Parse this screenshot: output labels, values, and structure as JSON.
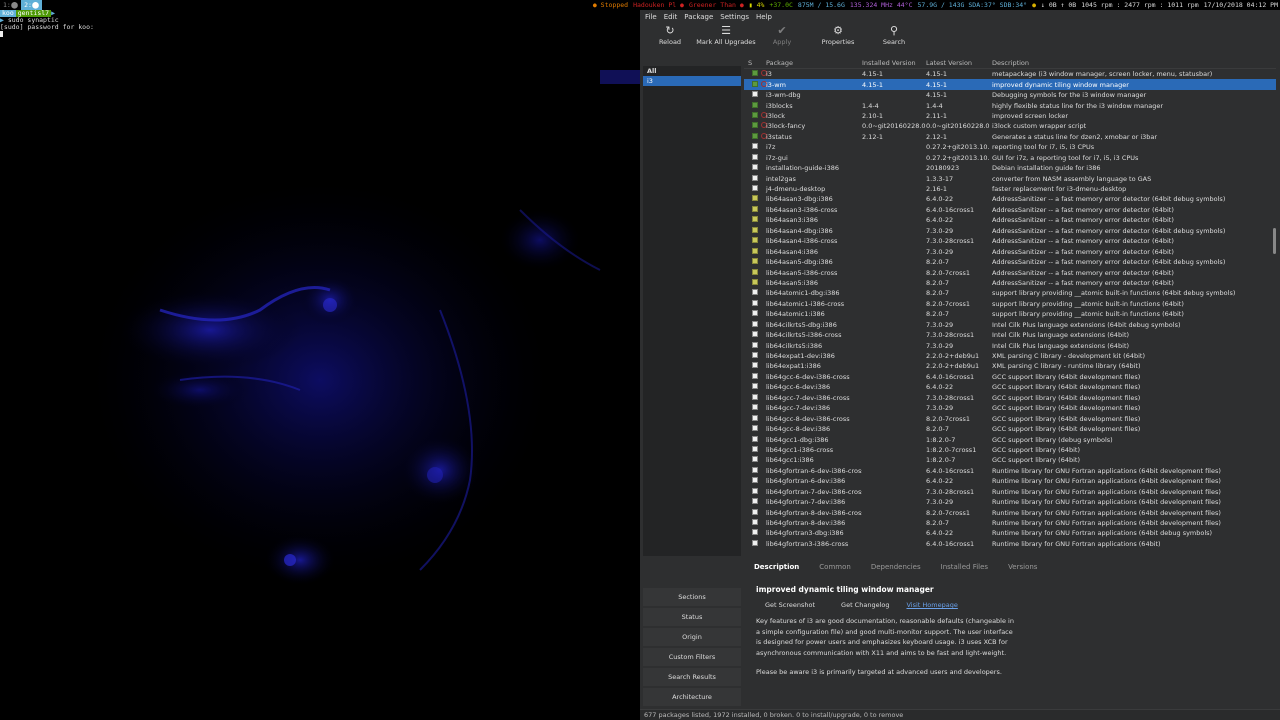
{
  "topbar": {
    "workspaces": [
      {
        "label": "1:⬤",
        "active": false
      },
      {
        "label": "2:⬤",
        "active": true
      }
    ],
    "status": [
      {
        "text": "● Stopped",
        "color": "#e07b00"
      },
      {
        "text": "Hadouken Pl ●",
        "color": "#c22"
      },
      {
        "text": "Greener Than ●",
        "color": "#c22"
      },
      {
        "text": "▮ 4%",
        "color": "#d7d700"
      },
      {
        "text": "+37.0C",
        "color": "#5faf00"
      },
      {
        "text": "875M / 15.6G",
        "color": "#5fafd7"
      },
      {
        "text": "135.324 MHz 44°C",
        "color": "#af5fd7"
      },
      {
        "text": "57.9G / 143G SDA:37° SDB:34°",
        "color": "#5fafd7"
      },
      {
        "text": "●",
        "color": "#d7af00"
      },
      {
        "text": "↓ 0B ↑ 0B",
        "color": "#ddd"
      },
      {
        "text": "1045 rpm : 2477 rpm : 1011 rpm",
        "color": "#ddd"
      },
      {
        "text": "17/10/2018 04:12 PM",
        "color": "#ddd"
      }
    ]
  },
  "terminal": {
    "prompt_user": "koo",
    "prompt_path": "gentisl7",
    "command": " sudo synaptic",
    "password_line": "[sudo] password for koo:"
  },
  "synaptic": {
    "menu": [
      "File",
      "Edit",
      "Package",
      "Settings",
      "Help"
    ],
    "toolbar": [
      {
        "label": "Reload",
        "icon": "reload-icon",
        "glyph": "↻",
        "disabled": false
      },
      {
        "label": "Mark All Upgrades",
        "icon": "mark-upgrades-icon",
        "glyph": "☰",
        "disabled": false
      },
      {
        "label": "Apply",
        "icon": "apply-icon",
        "glyph": "✔",
        "disabled": true
      },
      {
        "label": "Properties",
        "icon": "properties-icon",
        "glyph": "⚙",
        "disabled": false
      },
      {
        "label": "Search",
        "icon": "search-icon",
        "glyph": "⚲",
        "disabled": false
      }
    ],
    "filters": {
      "header": "All",
      "items": [
        "i3"
      ]
    },
    "columns": {
      "s": "S",
      "package": "Package",
      "installed": "Installed Version",
      "latest": "Latest Version",
      "description": "Description"
    },
    "packages": [
      {
        "name": "i3",
        "installed": "4.15-1",
        "latest": "4.15-1",
        "desc": "metapackage (i3 window manager, screen locker, menu, statusbar)",
        "state": "installed",
        "sup": true
      },
      {
        "name": "i3-wm",
        "installed": "4.15-1",
        "latest": "4.15-1",
        "desc": "improved dynamic tiling window manager",
        "state": "installed",
        "sup": true,
        "selected": true
      },
      {
        "name": "i3-wm-dbg",
        "installed": "",
        "latest": "4.15-1",
        "desc": "Debugging symbols for the i3 window manager",
        "state": "none",
        "sup": false
      },
      {
        "name": "i3blocks",
        "installed": "1.4-4",
        "latest": "1.4-4",
        "desc": "highly flexible status line for the i3 window manager",
        "state": "installed",
        "sup": false
      },
      {
        "name": "i3lock",
        "installed": "2.10-1",
        "latest": "2.11-1",
        "desc": "improved screen locker",
        "state": "installed",
        "sup": true
      },
      {
        "name": "i3lock-fancy",
        "installed": "0.0~git20160228.0",
        "latest": "0.0~git20160228.0",
        "desc": "i3lock custom wrapper script",
        "state": "installed",
        "sup": true
      },
      {
        "name": "i3status",
        "installed": "2.12-1",
        "latest": "2.12-1",
        "desc": "Generates a status line for dzen2, xmobar or i3bar",
        "state": "installed",
        "sup": true
      },
      {
        "name": "i7z",
        "installed": "",
        "latest": "0.27.2+git2013.10.",
        "desc": "reporting tool for i7, i5, i3 CPUs",
        "state": "none",
        "sup": false
      },
      {
        "name": "i7z-gui",
        "installed": "",
        "latest": "0.27.2+git2013.10.",
        "desc": "GUI for i7z, a reporting tool for i7, i5, i3 CPUs",
        "state": "none",
        "sup": false
      },
      {
        "name": "installation-guide-i386",
        "installed": "",
        "latest": "20180923",
        "desc": "Debian installation guide for i386",
        "state": "none",
        "sup": false
      },
      {
        "name": "intel2gas",
        "installed": "",
        "latest": "1.3.3-17",
        "desc": "converter from NASM assembly language to GAS",
        "state": "none",
        "sup": false
      },
      {
        "name": "j4-dmenu-desktop",
        "installed": "",
        "latest": "2.16-1",
        "desc": "faster replacement for i3-dmenu-desktop",
        "state": "none",
        "sup": false
      },
      {
        "name": "lib64asan3-dbg:i386",
        "installed": "",
        "latest": "6.4.0-22",
        "desc": "AddressSanitizer -- a fast memory error detector (64bit debug symbols)",
        "state": "upgradable",
        "sup": false
      },
      {
        "name": "lib64asan3-i386-cross",
        "installed": "",
        "latest": "6.4.0-16cross1",
        "desc": "AddressSanitizer -- a fast memory error detector (64bit)",
        "state": "upgradable",
        "sup": false
      },
      {
        "name": "lib64asan3:i386",
        "installed": "",
        "latest": "6.4.0-22",
        "desc": "AddressSanitizer -- a fast memory error detector (64bit)",
        "state": "upgradable",
        "sup": false
      },
      {
        "name": "lib64asan4-dbg:i386",
        "installed": "",
        "latest": "7.3.0-29",
        "desc": "AddressSanitizer -- a fast memory error detector (64bit debug symbols)",
        "state": "upgradable",
        "sup": false
      },
      {
        "name": "lib64asan4-i386-cross",
        "installed": "",
        "latest": "7.3.0-28cross1",
        "desc": "AddressSanitizer -- a fast memory error detector (64bit)",
        "state": "upgradable",
        "sup": false
      },
      {
        "name": "lib64asan4:i386",
        "installed": "",
        "latest": "7.3.0-29",
        "desc": "AddressSanitizer -- a fast memory error detector (64bit)",
        "state": "upgradable",
        "sup": false
      },
      {
        "name": "lib64asan5-dbg:i386",
        "installed": "",
        "latest": "8.2.0-7",
        "desc": "AddressSanitizer -- a fast memory error detector (64bit debug symbols)",
        "state": "upgradable",
        "sup": false
      },
      {
        "name": "lib64asan5-i386-cross",
        "installed": "",
        "latest": "8.2.0-7cross1",
        "desc": "AddressSanitizer -- a fast memory error detector (64bit)",
        "state": "upgradable",
        "sup": false
      },
      {
        "name": "lib64asan5:i386",
        "installed": "",
        "latest": "8.2.0-7",
        "desc": "AddressSanitizer -- a fast memory error detector (64bit)",
        "state": "upgradable",
        "sup": false
      },
      {
        "name": "lib64atomic1-dbg:i386",
        "installed": "",
        "latest": "8.2.0-7",
        "desc": "support library providing __atomic built-in functions (64bit debug symbols)",
        "state": "none",
        "sup": false
      },
      {
        "name": "lib64atomic1-i386-cross",
        "installed": "",
        "latest": "8.2.0-7cross1",
        "desc": "support library providing __atomic built-in functions (64bit)",
        "state": "none",
        "sup": false
      },
      {
        "name": "lib64atomic1:i386",
        "installed": "",
        "latest": "8.2.0-7",
        "desc": "support library providing __atomic built-in functions (64bit)",
        "state": "none",
        "sup": false
      },
      {
        "name": "lib64cilkrts5-dbg:i386",
        "installed": "",
        "latest": "7.3.0-29",
        "desc": "Intel Cilk Plus language extensions (64bit debug symbols)",
        "state": "none",
        "sup": false
      },
      {
        "name": "lib64cilkrts5-i386-cross",
        "installed": "",
        "latest": "7.3.0-28cross1",
        "desc": "Intel Cilk Plus language extensions (64bit)",
        "state": "none",
        "sup": false
      },
      {
        "name": "lib64cilkrts5:i386",
        "installed": "",
        "latest": "7.3.0-29",
        "desc": "Intel Cilk Plus language extensions (64bit)",
        "state": "none",
        "sup": false
      },
      {
        "name": "lib64expat1-dev:i386",
        "installed": "",
        "latest": "2.2.0-2+deb9u1",
        "desc": "XML parsing C library - development kit (64bit)",
        "state": "none",
        "sup": false
      },
      {
        "name": "lib64expat1:i386",
        "installed": "",
        "latest": "2.2.0-2+deb9u1",
        "desc": "XML parsing C library - runtime library (64bit)",
        "state": "none",
        "sup": false
      },
      {
        "name": "lib64gcc-6-dev-i386-cross",
        "installed": "",
        "latest": "6.4.0-16cross1",
        "desc": "GCC support library (64bit development files)",
        "state": "none",
        "sup": false
      },
      {
        "name": "lib64gcc-6-dev:i386",
        "installed": "",
        "latest": "6.4.0-22",
        "desc": "GCC support library (64bit development files)",
        "state": "none",
        "sup": false
      },
      {
        "name": "lib64gcc-7-dev-i386-cross",
        "installed": "",
        "latest": "7.3.0-28cross1",
        "desc": "GCC support library (64bit development files)",
        "state": "none",
        "sup": false
      },
      {
        "name": "lib64gcc-7-dev:i386",
        "installed": "",
        "latest": "7.3.0-29",
        "desc": "GCC support library (64bit development files)",
        "state": "none",
        "sup": false
      },
      {
        "name": "lib64gcc-8-dev-i386-cross",
        "installed": "",
        "latest": "8.2.0-7cross1",
        "desc": "GCC support library (64bit development files)",
        "state": "none",
        "sup": false
      },
      {
        "name": "lib64gcc-8-dev:i386",
        "installed": "",
        "latest": "8.2.0-7",
        "desc": "GCC support library (64bit development files)",
        "state": "none",
        "sup": false
      },
      {
        "name": "lib64gcc1-dbg:i386",
        "installed": "",
        "latest": "1:8.2.0-7",
        "desc": "GCC support library (debug symbols)",
        "state": "none",
        "sup": false
      },
      {
        "name": "lib64gcc1-i386-cross",
        "installed": "",
        "latest": "1:8.2.0-7cross1",
        "desc": "GCC support library (64bit)",
        "state": "none",
        "sup": false
      },
      {
        "name": "lib64gcc1:i386",
        "installed": "",
        "latest": "1:8.2.0-7",
        "desc": "GCC support library (64bit)",
        "state": "none",
        "sup": false
      },
      {
        "name": "lib64gfortran-6-dev-i386-cross",
        "installed": "",
        "latest": "6.4.0-16cross1",
        "desc": "Runtime library for GNU Fortran applications (64bit development files)",
        "state": "none",
        "sup": false
      },
      {
        "name": "lib64gfortran-6-dev:i386",
        "installed": "",
        "latest": "6.4.0-22",
        "desc": "Runtime library for GNU Fortran applications (64bit development files)",
        "state": "none",
        "sup": false
      },
      {
        "name": "lib64gfortran-7-dev-i386-cross",
        "installed": "",
        "latest": "7.3.0-28cross1",
        "desc": "Runtime library for GNU Fortran applications (64bit development files)",
        "state": "none",
        "sup": false
      },
      {
        "name": "lib64gfortran-7-dev:i386",
        "installed": "",
        "latest": "7.3.0-29",
        "desc": "Runtime library for GNU Fortran applications (64bit development files)",
        "state": "none",
        "sup": false
      },
      {
        "name": "lib64gfortran-8-dev-i386-cross",
        "installed": "",
        "latest": "8.2.0-7cross1",
        "desc": "Runtime library for GNU Fortran applications (64bit development files)",
        "state": "none",
        "sup": false
      },
      {
        "name": "lib64gfortran-8-dev:i386",
        "installed": "",
        "latest": "8.2.0-7",
        "desc": "Runtime library for GNU Fortran applications (64bit development files)",
        "state": "none",
        "sup": false
      },
      {
        "name": "lib64gfortran3-dbg:i386",
        "installed": "",
        "latest": "6.4.0-22",
        "desc": "Runtime library for GNU Fortran applications (64bit debug symbols)",
        "state": "none",
        "sup": false
      },
      {
        "name": "lib64gfortran3-i386-cross",
        "installed": "",
        "latest": "6.4.0-16cross1",
        "desc": "Runtime library for GNU Fortran applications (64bit)",
        "state": "none",
        "sup": false
      }
    ],
    "sections": [
      "Sections",
      "Status",
      "Origin",
      "Custom Filters",
      "Search Results",
      "Architecture"
    ],
    "tabs": [
      "Description",
      "Common",
      "Dependencies",
      "Installed Files",
      "Versions"
    ],
    "active_tab": "Description",
    "detail": {
      "title": "improved dynamic tiling window manager",
      "get_screenshot": "Get Screenshot",
      "get_changelog": "Get Changelog",
      "visit_homepage": "Visit Homepage",
      "body": "Key features of i3 are good documentation, reasonable defaults (changeable in a simple configuration file) and good multi-monitor support. The user interface is designed for power users and emphasizes keyboard usage. i3 uses XCB for asynchronous communication with X11 and aims to be fast and light-weight.",
      "body2": "Please be aware i3 is primarily targeted at advanced users and developers."
    },
    "statusbar": "677 packages listed, 1972 installed, 0 broken. 0 to install/upgrade, 0 to remove"
  }
}
